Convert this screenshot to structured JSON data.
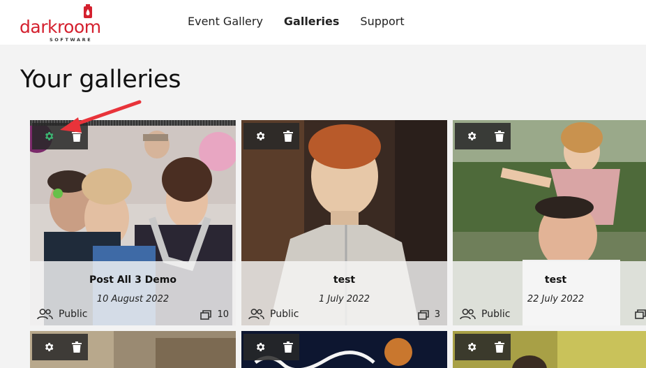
{
  "brand": {
    "name": "darkroom",
    "tagline": "SOFTWARE",
    "accent": "#d4202e"
  },
  "nav": {
    "items": [
      {
        "label": "Event Gallery"
      },
      {
        "label": "Galleries",
        "active": true
      },
      {
        "label": "Support"
      }
    ]
  },
  "page": {
    "title": "Your galleries"
  },
  "galleries": [
    {
      "name": "Post All 3 Demo",
      "date": "10 August 2022",
      "visibility": "Public",
      "photo_count": "10"
    },
    {
      "name": "test",
      "date": "1 July 2022",
      "visibility": "Public",
      "photo_count": "3"
    },
    {
      "name": "test",
      "date": "22 July 2022",
      "visibility": "Public",
      "photo_count": ""
    }
  ],
  "icons": {
    "settings": "gear-icon",
    "delete": "trash-icon",
    "visibility": "people-icon",
    "count": "photos-icon"
  },
  "colors": {
    "settings_highlight": "#3cb371",
    "annotation_arrow": "#e8333a"
  }
}
